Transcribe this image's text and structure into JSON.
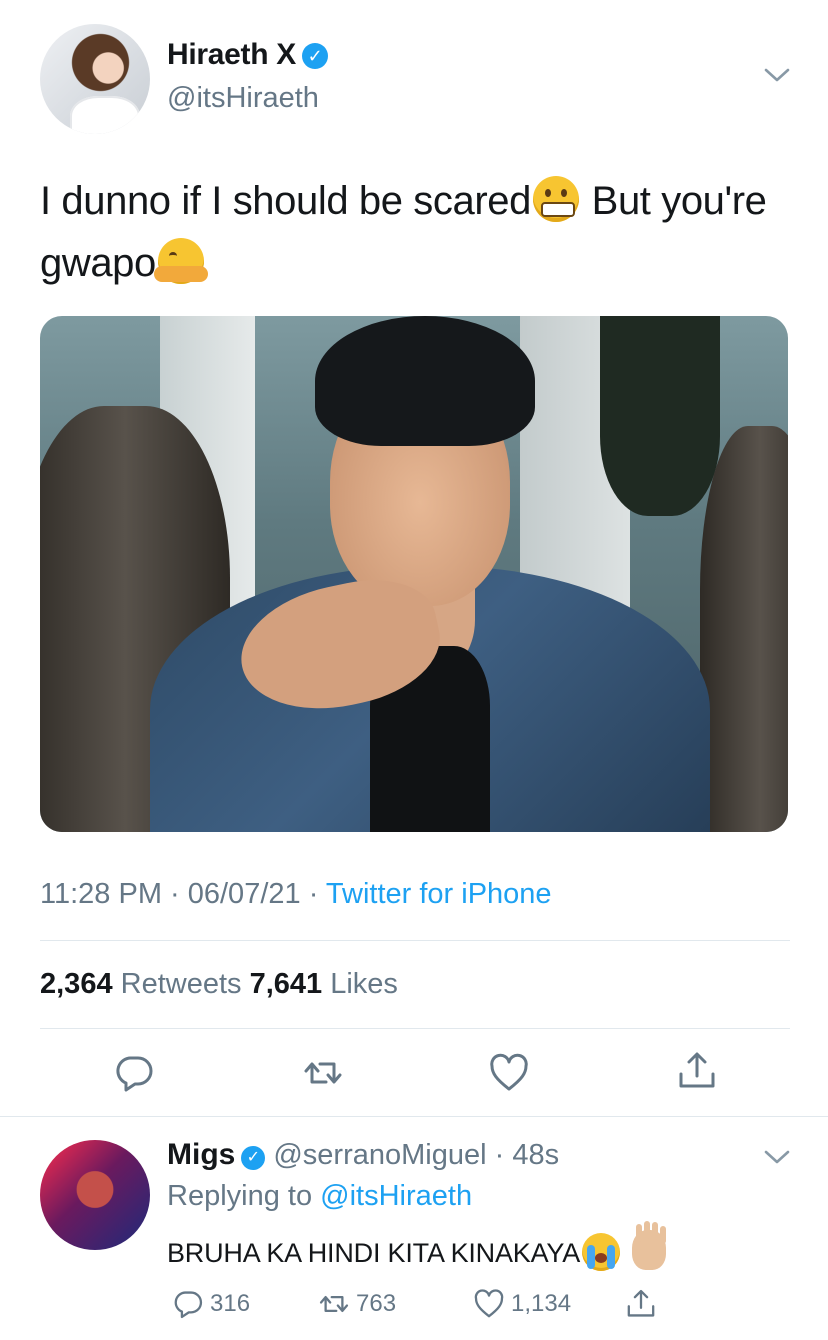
{
  "tweet": {
    "author_name": "Hiraeth X",
    "author_handle": "@itsHiraeth",
    "text_part1": "I dunno if I should be scared",
    "text_part2": " But you're gwapo",
    "timestamp": "11:28 PM · 06/07/21 · ",
    "source": "Twitter for iPhone",
    "retweets_count": "2,364",
    "retweets_label": " Retweets ",
    "likes_count": "7,641",
    "likes_label": " Likes",
    "emojis": [
      "grimacing-face-emoji",
      "hugging-face-emoji"
    ]
  },
  "reply": {
    "author_name": "Migs",
    "author_handle": "@serranoMiguel",
    "time": " · 48s",
    "replying_label": "Replying to ",
    "replying_to": "@itsHiraeth",
    "text": "BRUHA KA HINDI KITA KINAKAYA",
    "emojis": [
      "loudly-crying-face-emoji",
      "raised-hand-emoji"
    ],
    "reply_count": "316",
    "retweet_count": "763",
    "like_count": "1,134"
  },
  "colors": {
    "accent": "#1da1f2",
    "secondary_text": "#657786",
    "primary_text": "#14171a",
    "divider": "#e1e8ed"
  }
}
